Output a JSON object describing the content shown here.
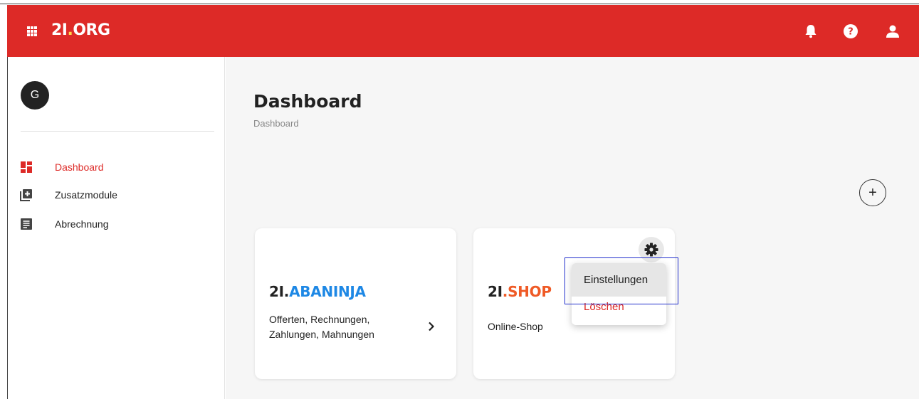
{
  "header": {
    "logo_main": "2I",
    "logo_dot": ".",
    "logo_suffix": "ORG",
    "brand_color": "#dd2a27",
    "icons": [
      "apps-grid-icon",
      "bell-icon",
      "help-icon",
      "user-icon"
    ]
  },
  "sidebar": {
    "avatar_initial": "G",
    "items": [
      {
        "label": "Dashboard",
        "icon": "dashboard-icon",
        "active": true
      },
      {
        "label": "Zusatzmodule",
        "icon": "add-module-icon",
        "active": false
      },
      {
        "label": "Abrechnung",
        "icon": "billing-icon",
        "active": false
      }
    ]
  },
  "main": {
    "title": "Dashboard",
    "breadcrumb": "Dashboard",
    "add_button": "+",
    "cards": [
      {
        "logo_prefix": "2I",
        "logo_dot": ".",
        "logo_name": "ABANINJA",
        "logo_color": "#1e88e5",
        "description_line1": "Offerten, Rechnungen,",
        "description_line2": "Zahlungen, Mahnungen",
        "icon": "chevron-right-icon"
      },
      {
        "logo_prefix": "2I",
        "logo_dot": ".",
        "logo_name": "SHOP",
        "logo_color": "#ef5a26",
        "description_line1": "Online-Shop",
        "icon": "gear-icon"
      }
    ],
    "context_menu": {
      "items": [
        {
          "label": "Einstellungen",
          "highlighted": true
        },
        {
          "label": "Löschen",
          "danger": true
        }
      ]
    }
  }
}
